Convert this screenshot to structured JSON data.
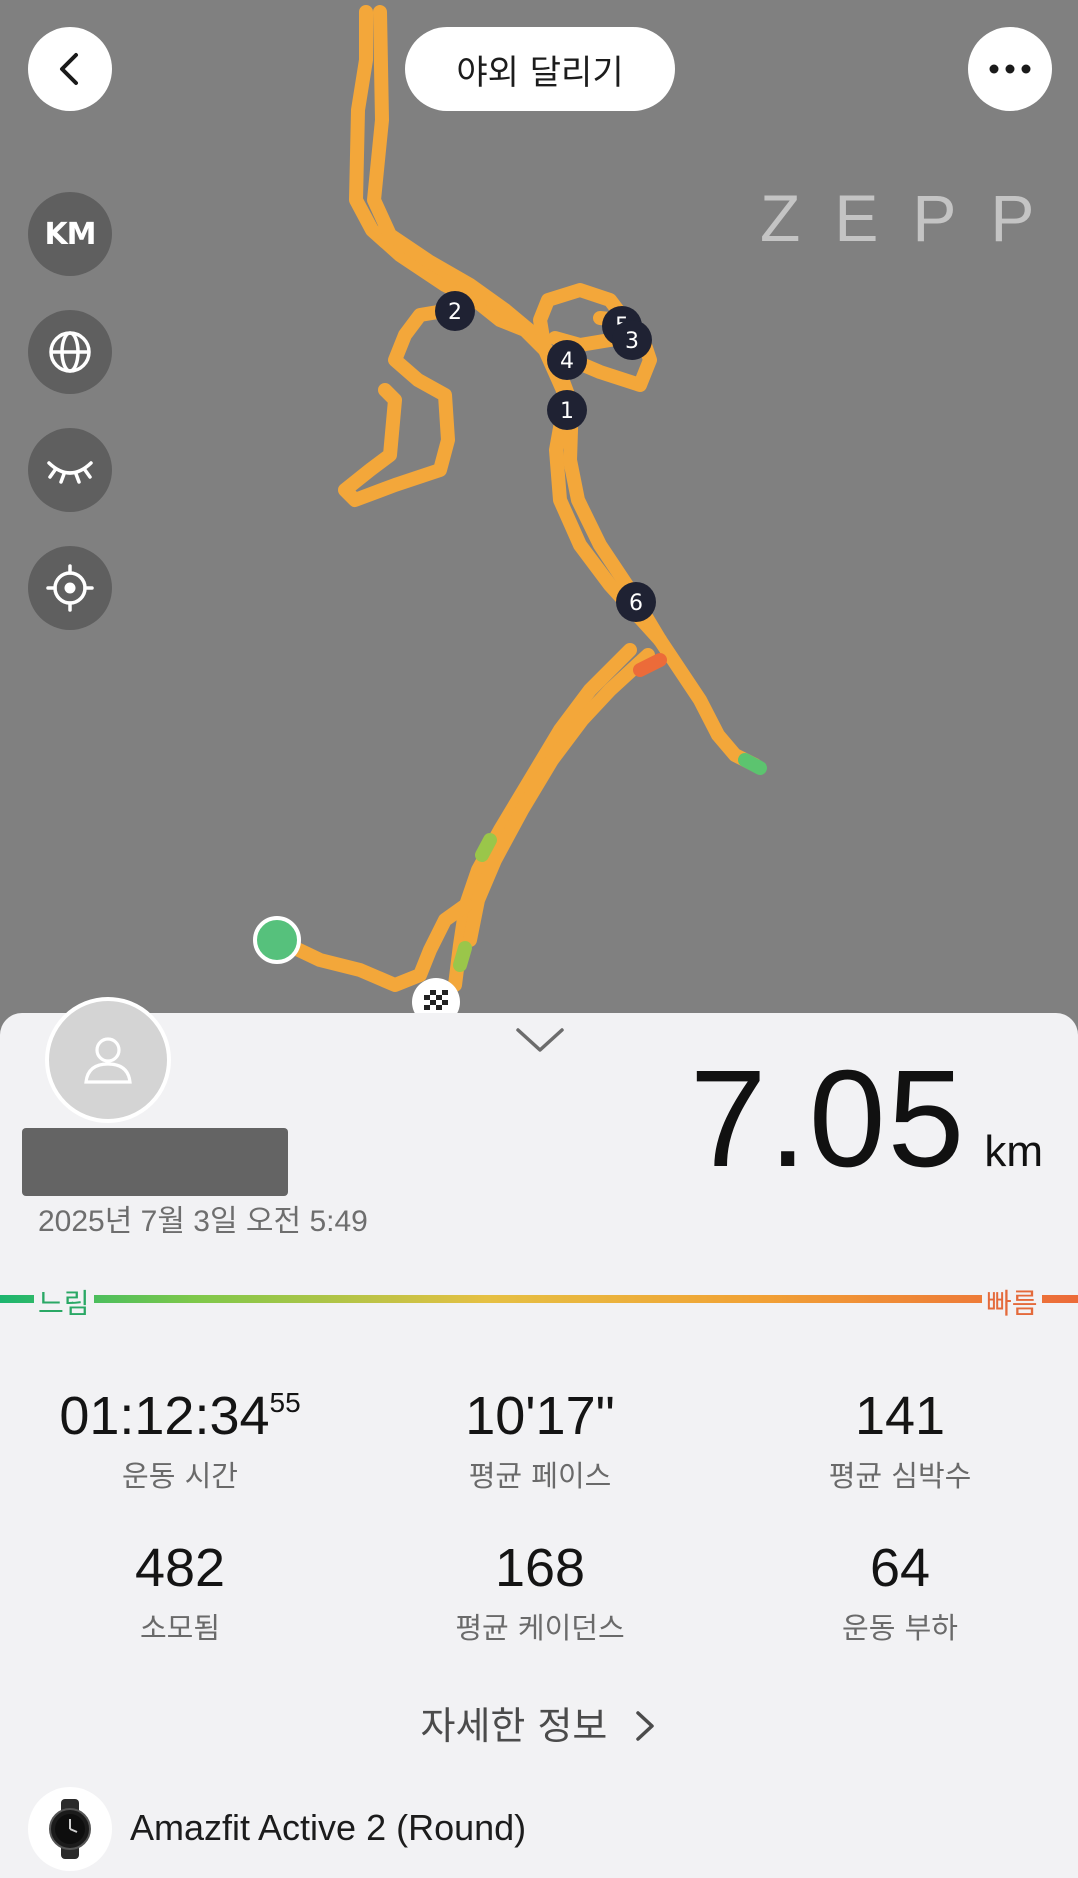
{
  "header": {
    "title": "야외 달리기"
  },
  "map": {
    "unit_toggle": "KM",
    "brand_logo": "ZEPP",
    "markers": [
      "1",
      "2",
      "3",
      "4",
      "5",
      "6"
    ],
    "route_color": "#f3a73a"
  },
  "summary": {
    "date": "2025년 7월 3일 오전 5:49",
    "distance": "7.05",
    "distance_unit": "km",
    "slow_label": "느림",
    "fast_label": "빠름"
  },
  "stats": [
    {
      "value": "01:12:34",
      "sub": "55",
      "label": "운동 시간"
    },
    {
      "value": "10'17\"",
      "label": "평균 페이스"
    },
    {
      "value": "141",
      "label": "평균 심박수"
    },
    {
      "value": "482",
      "label": "소모됨"
    },
    {
      "value": "168",
      "label": "평균 케이던스"
    },
    {
      "value": "64",
      "label": "운동 부하"
    }
  ],
  "details_link": "자세한 정보",
  "device": {
    "name": "Amazfit Active 2 (Round)"
  }
}
